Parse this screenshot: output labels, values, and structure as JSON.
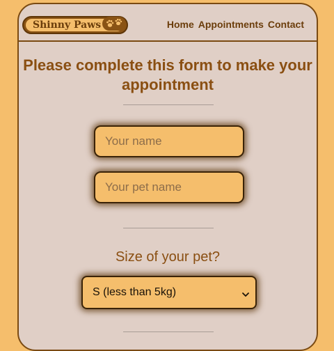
{
  "brand": {
    "name": "Shinny Paws",
    "logo_icon": "paw-prints-icon"
  },
  "nav": {
    "items": [
      {
        "label": "Home"
      },
      {
        "label": "Appointments"
      },
      {
        "label": "Contact"
      }
    ]
  },
  "form": {
    "heading": "Please complete this form to make your appointment",
    "name_placeholder": "Your name",
    "pet_name_placeholder": "Your pet name",
    "size_label": "Size of your pet?",
    "size_selected": "S (less than 5kg)",
    "size_icon": "chevron-down-icon"
  },
  "colors": {
    "background": "#f5be6c",
    "panel": "#e0cfc6",
    "brown": "#8a4f12",
    "dark_brown": "#3a2308"
  }
}
